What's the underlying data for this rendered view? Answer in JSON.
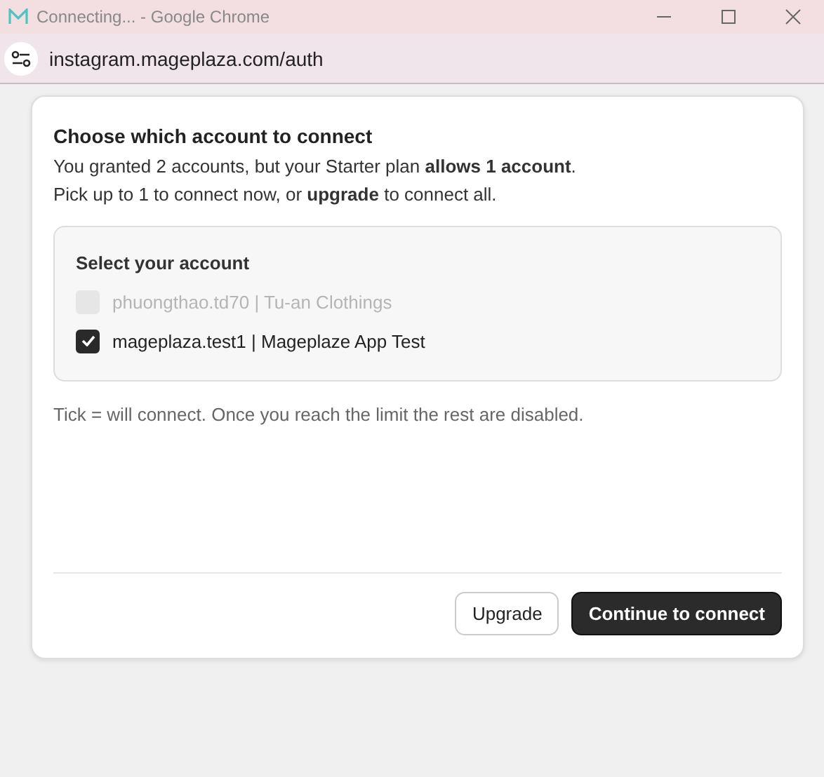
{
  "window": {
    "title": "Connecting... - Google Chrome"
  },
  "address_bar": {
    "url": "instagram.mageplaza.com/auth"
  },
  "dialog": {
    "title": "Choose which account to connect",
    "description": [
      "You granted 2 accounts, but your Starter plan **allows 1 account**.",
      "Pick up to 1 to connect now, or **upgrade** to connect all."
    ],
    "account_panel": {
      "heading": "Select your account",
      "accounts": [
        {
          "label": "phuongthao.td70 | Tu-an Clothings",
          "checked": false,
          "disabled": true
        },
        {
          "label": "mageplaza.test1 | Mageplaze App Test",
          "checked": true,
          "disabled": false
        }
      ]
    },
    "hint": "Tick = will connect. Once you reach the limit the rest are disabled.",
    "buttons": [
      {
        "label": "Upgrade",
        "kind": "secondary"
      },
      {
        "label": "Continue to connect",
        "kind": "primary"
      }
    ]
  }
}
